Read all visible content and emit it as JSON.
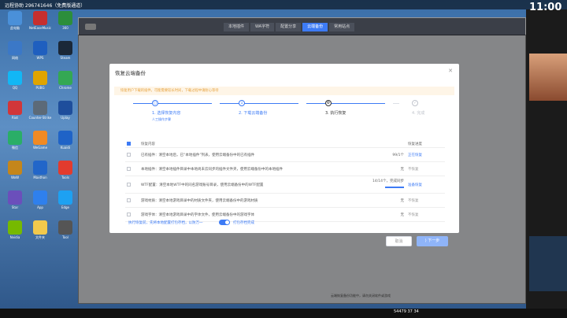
{
  "desktop": {
    "top_text": "远程协助 296741646（免费版通道）",
    "clock": "11:00",
    "taskbar_status": "54479 37 34"
  },
  "desktop_icons": [
    {
      "label": "此电脑",
      "color": "#4a90d9"
    },
    {
      "label": "NetEaseMusic",
      "color": "#c62f2f"
    },
    {
      "label": "360",
      "color": "#2c8e3c"
    },
    {
      "label": "网络",
      "color": "#3b78c7"
    },
    {
      "label": "WPS",
      "color": "#1f5fbf"
    },
    {
      "label": "Steam",
      "color": "#1b2838"
    },
    {
      "label": "QQ",
      "color": "#12b7f5"
    },
    {
      "label": "PUBG",
      "color": "#e0a400"
    },
    {
      "label": "Chrome",
      "color": "#34a853"
    },
    {
      "label": "Riot",
      "color": "#d13639"
    },
    {
      "label": "Counter-Strike",
      "color": "#5c6a78"
    },
    {
      "label": "Uplay",
      "color": "#1e4e9c"
    },
    {
      "label": "微信",
      "color": "#2aae67"
    },
    {
      "label": "WeGame",
      "color": "#f08a24"
    },
    {
      "label": "Kuaidi",
      "color": "#1f63c7"
    },
    {
      "label": "WoW",
      "color": "#c4861b"
    },
    {
      "label": "Maxthon",
      "color": "#2266c9"
    },
    {
      "label": "Tools",
      "color": "#e23b2e"
    },
    {
      "label": "Star",
      "color": "#6b4fbb"
    },
    {
      "label": "App",
      "color": "#2f80ed"
    },
    {
      "label": "Edge",
      "color": "#1da1f2"
    },
    {
      "label": "Nvidia",
      "color": "#76b900"
    },
    {
      "label": "文件夹",
      "color": "#f2c94c"
    },
    {
      "label": "Tool",
      "color": "#555555"
    }
  ],
  "app": {
    "tabs": [
      "本地插件",
      "WA字符",
      "配置分享",
      "云端备份",
      "常用站点"
    ],
    "active_tab_index": 3,
    "bottom_text": "云端恢复备份功能中，请勿关闭软件或游戏"
  },
  "dialog": {
    "title": "恢复云端备份",
    "close_icon": "close-icon",
    "warning": "恢复用户下载的插件，可能需要较长时间，下载过程中请耐心等待",
    "steps": [
      {
        "label": "1. 选择恢复内容",
        "sub": "人工操作步骤",
        "state": "done"
      },
      {
        "label": "2. 下载云端备份",
        "sub": "",
        "state": "done"
      },
      {
        "label": "3. 执行恢复",
        "sub": "",
        "state": "active"
      },
      {
        "label": "4. 完成",
        "sub": "",
        "state": "pending"
      }
    ],
    "table": {
      "col_content": "恢复内容",
      "col_result": "恢复进度",
      "rows": [
        {
          "content": "已有插件：清空本地后，已“本地插件”列表，使用云端备份中的已有插件",
          "count": "99/1个",
          "result": "正在恢复",
          "status": "active",
          "checked": false,
          "progress": 1.0
        },
        {
          "content": "本地插件：清空本地插件目录中本地尚未云同步的插件文件夹，使用云端备份中的本地插件",
          "count": "无",
          "result": "不恢复",
          "status": "skip",
          "checked": false,
          "progress": null
        },
        {
          "content": "WTF配置：清空本地WTF中的同名游戏账号目录，使用云端备份中的WTF配置",
          "count": "14/14个，完成同步",
          "result": "准备恢复",
          "status": "pending",
          "checked": false,
          "progress": 1.0
        },
        {
          "content": "游戏材质：清空本地游戏目录中的材质文件夹，使用云端备份中的游戏材质",
          "count": "无",
          "result": "不恢复",
          "status": "skip",
          "checked": false,
          "progress": null
        },
        {
          "content": "游戏字体：清空本地游戏目录中的字体文件，使用云端备份中的游戏字体",
          "count": "无",
          "result": "不恢复",
          "status": "skip",
          "checked": false,
          "progress": null
        }
      ]
    },
    "footer_text": "执行恢复前，先将本地配置打包存档，以防万一",
    "toggle_label": "打包存档完成",
    "toggle_on": true,
    "cancel_label": "取消",
    "next_label": "下一步"
  }
}
